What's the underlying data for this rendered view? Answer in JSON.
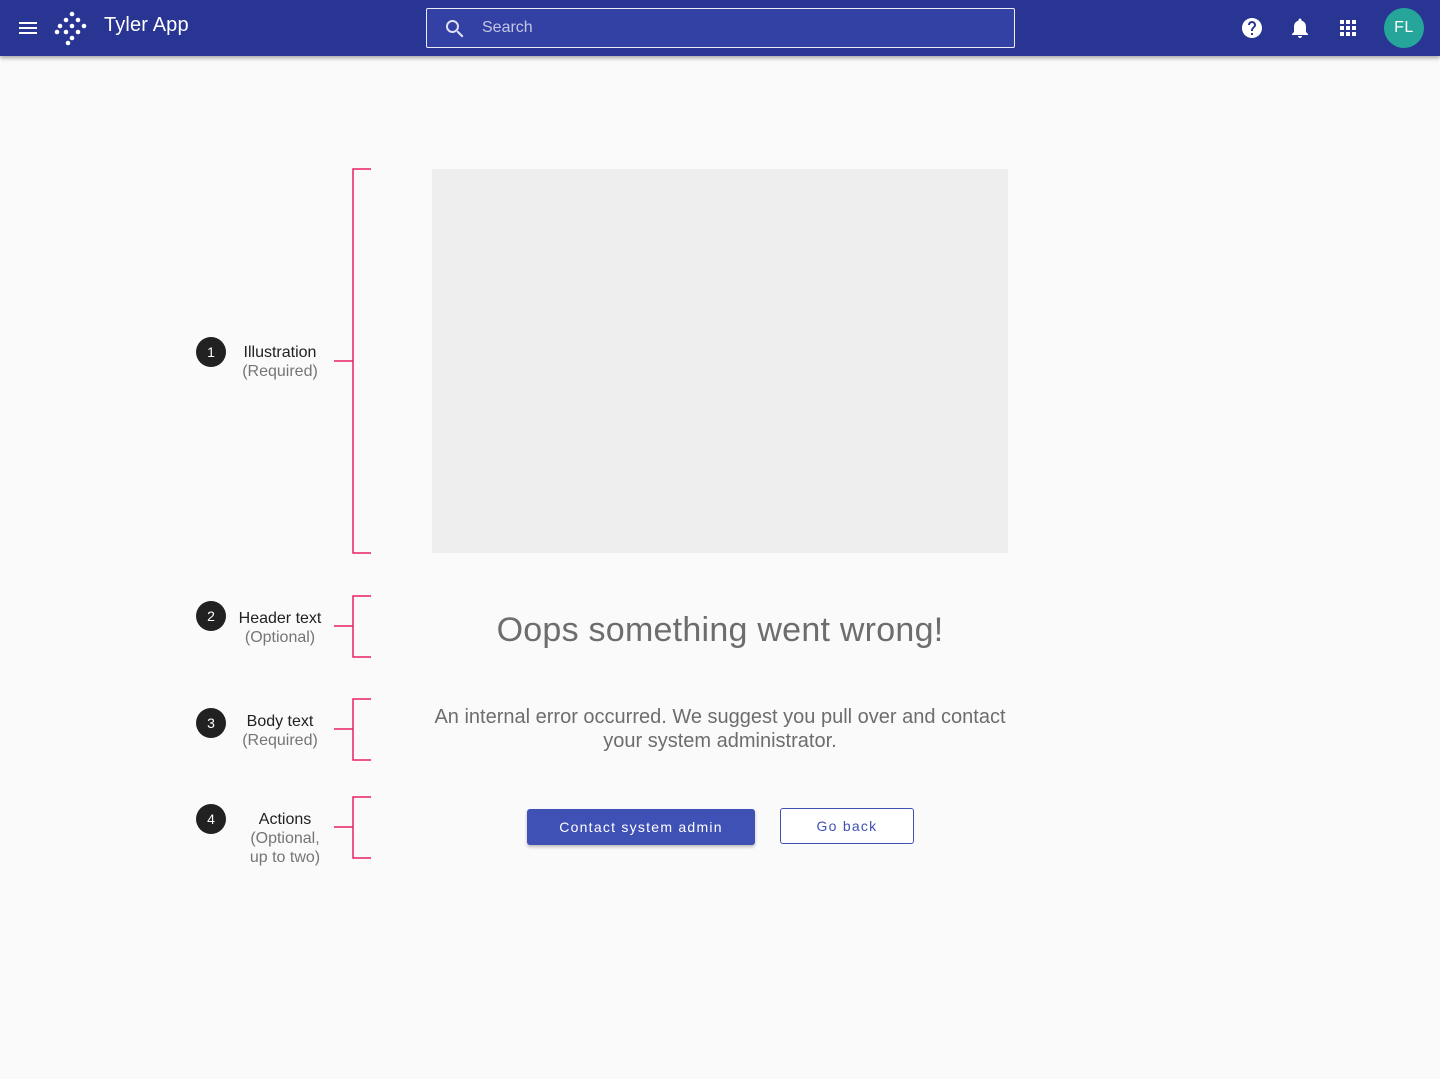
{
  "appbar": {
    "title": "Tyler App",
    "menu_icon": "menu-icon",
    "logo_icon": "tyler-logo-icon",
    "search": {
      "placeholder": "Search",
      "value": "",
      "icon": "search-icon"
    },
    "icons": [
      "help-icon",
      "bell-icon",
      "apps-grid-icon"
    ],
    "avatar_initials": "FL",
    "colors": {
      "background": "#283593",
      "avatar": "#26a69a"
    }
  },
  "annotations": [
    {
      "number": "1",
      "label": "Illustration",
      "sub": "(Required)"
    },
    {
      "number": "2",
      "label": "Header text",
      "sub": "(Optional)"
    },
    {
      "number": "3",
      "label": "Body text",
      "sub": "(Required)"
    },
    {
      "number": "4",
      "label": "Actions",
      "sub_line1": "(Optional,",
      "sub_line2": "up to two)"
    }
  ],
  "bracket_color": "#e91e63",
  "content": {
    "header": "Oops something went wrong!",
    "body": "An internal error occurred. We suggest you pull over and contact your system administrator.",
    "primary_action": "Contact system admin",
    "secondary_action": "Go back",
    "accent": "#3f51b5"
  }
}
